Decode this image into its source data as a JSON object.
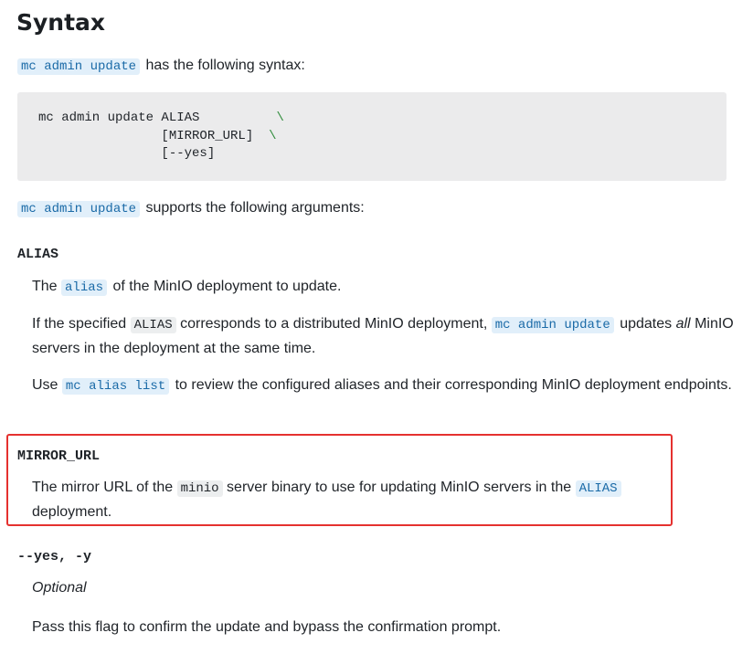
{
  "section_title": "Syntax",
  "intro": {
    "command": "mc admin update",
    "text": "has the following syntax:"
  },
  "code_block": {
    "line1": "mc admin update ALIAS",
    "line2": "[MIRROR_URL]",
    "line3": "[--yes]",
    "continuation": "\\"
  },
  "args_intro": {
    "command": "mc admin update",
    "text": "supports the following arguments:"
  },
  "alias_arg": {
    "term": "ALIAS",
    "p1_pre": "The",
    "p1_code": "alias",
    "p1_post": "of the MinIO deployment to update.",
    "p2_pre": "If the specified",
    "p2_code": "ALIAS",
    "p2_mid": "corresponds to a distributed MinIO deployment,",
    "p2_code2": "mc admin update",
    "p2_post": "updates",
    "p2_em": "all",
    "p2_end": "MinIO servers in the deployment at the same time.",
    "p3_pre": "Use",
    "p3_code": "mc alias list",
    "p3_post": "to review the configured aliases and their corresponding MinIO deployment",
    "p3_end": "endpoints."
  },
  "mirror_arg": {
    "term": "MIRROR_URL",
    "p1_pre": "The mirror URL of the",
    "p1_code": "minio",
    "p1_mid": "server binary to use for updating MinIO servers in the",
    "p1_code2": "ALIAS",
    "p1_end": "deployment."
  },
  "yes_arg": {
    "term": "--yes, -y",
    "optional": "Optional",
    "p1": "Pass this flag to confirm the update and bypass the confirmation prompt."
  },
  "colors": {
    "highlight_border": "#e5312f",
    "ref_code_text": "#1a6aa7",
    "ref_code_bg": "#e1effa",
    "code_block_bg": "#ebebec"
  }
}
